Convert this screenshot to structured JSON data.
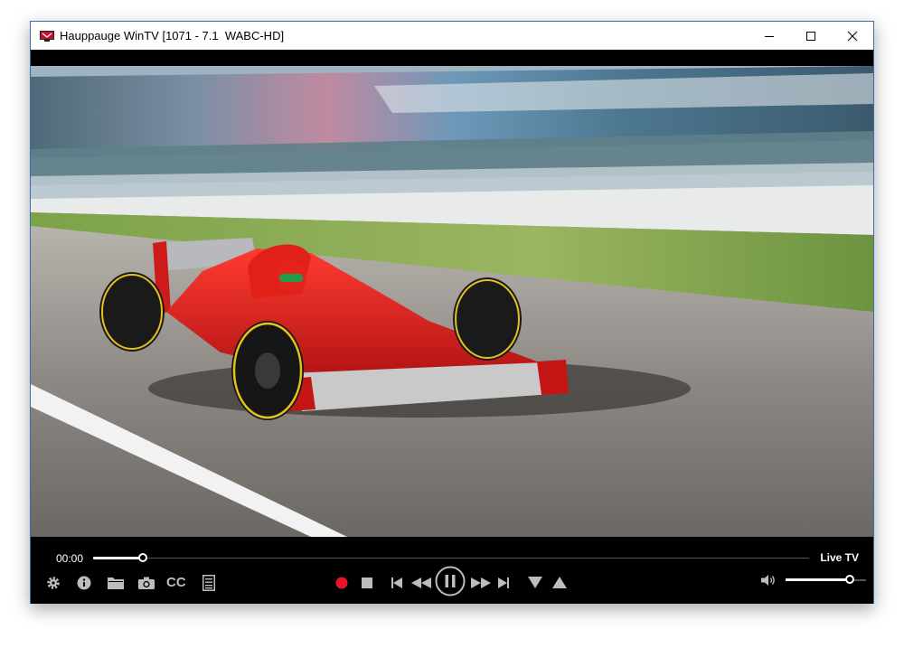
{
  "window": {
    "title": "Hauppauge WinTV [1071 - 7.1  WABC-HD]",
    "logo_icon": "hauppauge-logo-icon",
    "controls": [
      "minimize-icon",
      "maximize-icon",
      "close-icon"
    ]
  },
  "player": {
    "elapsed_time": "00:00",
    "mode_label": "Live TV",
    "seek_progress_percent": 7,
    "volume_percent": 80,
    "cc_label": "CC",
    "left_icons": [
      "gear-icon",
      "info-icon",
      "folder-icon",
      "camera-icon",
      "cc-icon",
      "list-icon"
    ],
    "center_icons": [
      "record-icon",
      "stop-icon",
      "skip-back-icon",
      "rewind-icon",
      "pause-icon",
      "fast-forward-icon",
      "skip-forward-icon",
      "channel-down-icon",
      "channel-up-icon"
    ],
    "right_icons": [
      "volume-icon"
    ],
    "colors": {
      "record": "#e8122a",
      "icon": "#bdbdbd",
      "accent_border": "#3a6fb0"
    }
  }
}
